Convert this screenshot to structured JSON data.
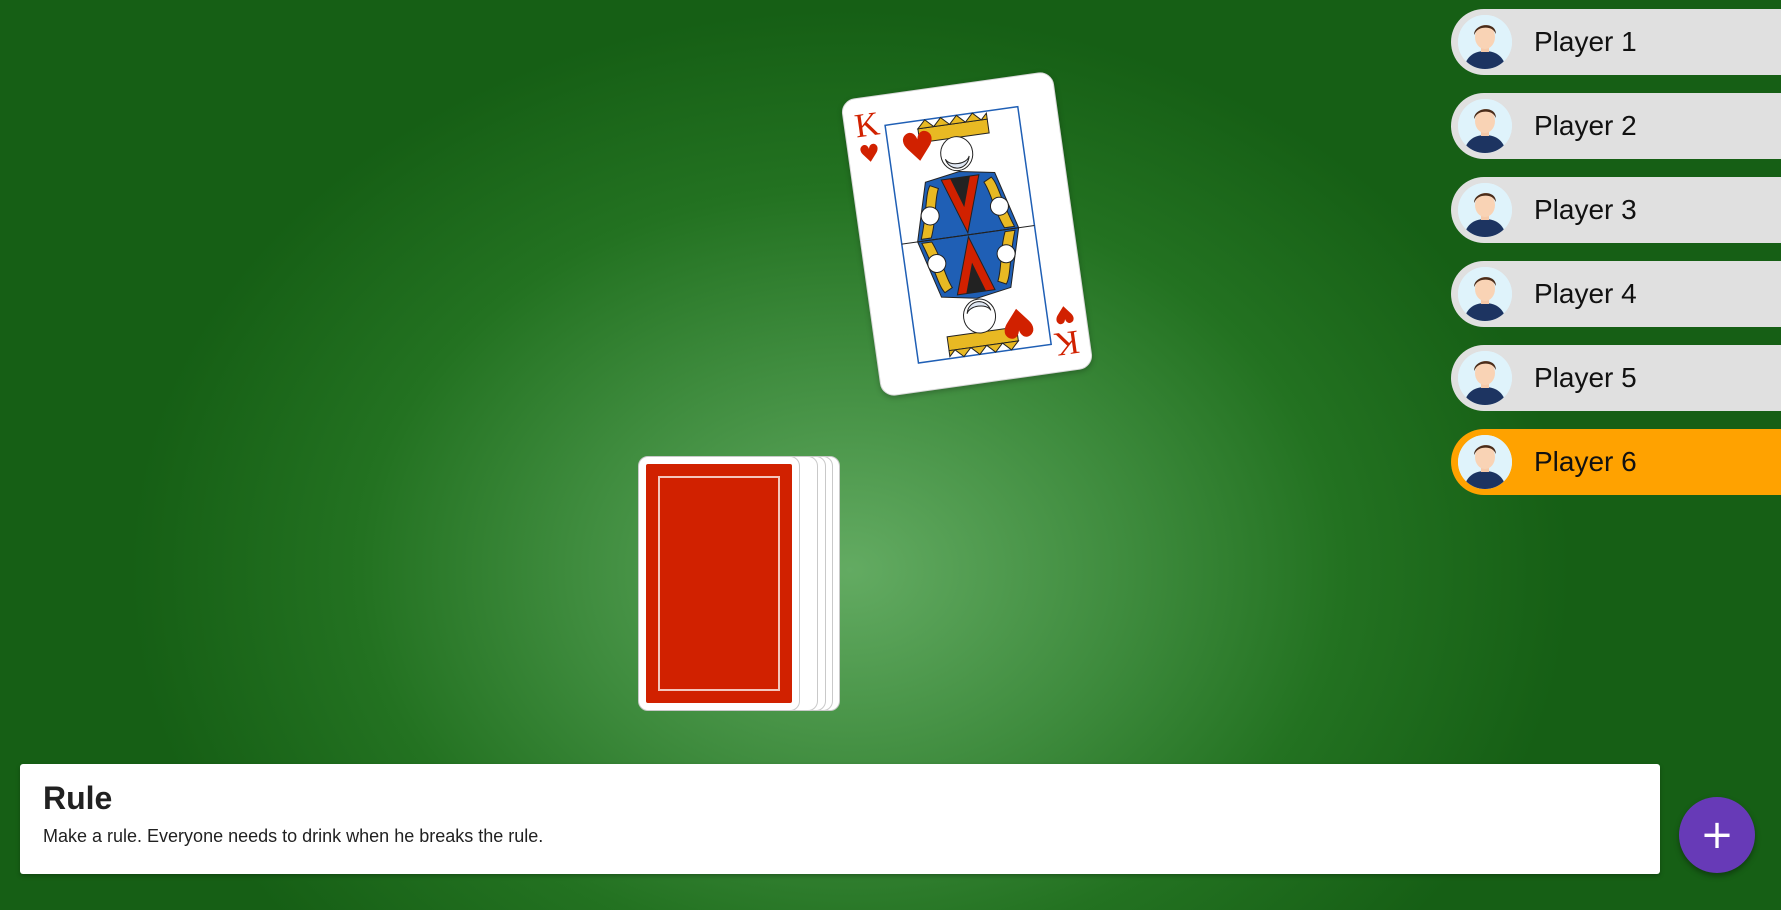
{
  "players": [
    {
      "name": "Player 1",
      "active": false
    },
    {
      "name": "Player 2",
      "active": false
    },
    {
      "name": "Player 3",
      "active": false
    },
    {
      "name": "Player 4",
      "active": false
    },
    {
      "name": "Player 5",
      "active": false
    },
    {
      "name": "Player 6",
      "active": true
    }
  ],
  "drawn_card": {
    "rank": "K",
    "suit": "hearts",
    "suit_symbol": "♥",
    "color": "#d12100"
  },
  "deck": {
    "back_color": "#d12100"
  },
  "rule": {
    "title": "Rule",
    "text": "Make a rule. Everyone needs to drink when he breaks the rule."
  },
  "fab": {
    "icon": "plus-icon",
    "symbol": "+",
    "color": "#673ab7"
  },
  "colors": {
    "active_player": "#ffa200",
    "player_bg": "#e0e0e0",
    "table_green": "#237221"
  }
}
